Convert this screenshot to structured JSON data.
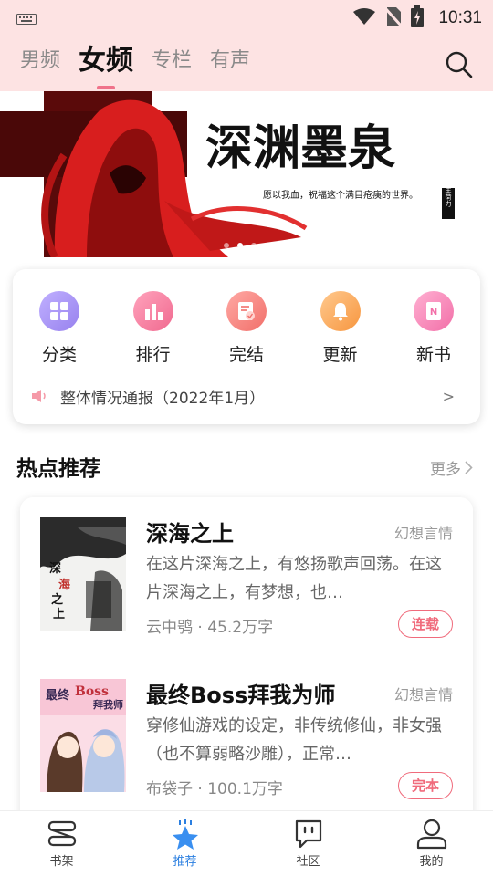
{
  "status_bar": {
    "time": "10:31"
  },
  "header": {
    "tabs": [
      {
        "label": "男频",
        "active": false
      },
      {
        "label": "女频",
        "active": true
      },
      {
        "label": "专栏",
        "active": false
      },
      {
        "label": "有声",
        "active": false
      }
    ],
    "search_icon": "search-icon"
  },
  "banner": {
    "title": "深渊墨泉",
    "subtitle": "愿以我血，祝福这个满目疮痍的世界。",
    "tag": "丰菏力",
    "dots": 3,
    "active_dot": 1
  },
  "quick_menu": {
    "items": [
      {
        "label": "分类",
        "icon": "grid-icon",
        "color": "#a893f0"
      },
      {
        "label": "排行",
        "icon": "bar-chart-icon",
        "color": "#f57fa0"
      },
      {
        "label": "完结",
        "icon": "completed-book-icon",
        "color": "#f6837f"
      },
      {
        "label": "更新",
        "icon": "bell-icon",
        "color": "#f9a35a"
      },
      {
        "label": "新书",
        "icon": "new-book-icon",
        "color": "#f48bb8"
      }
    ],
    "notice": {
      "text": "整体情况通报（2022年1月）",
      "arrow": ">",
      "icon": "speaker-icon"
    }
  },
  "hot": {
    "title": "热点推荐",
    "more": "更多",
    "books": [
      {
        "title": "深海之上",
        "genre": "幻想言情",
        "desc": "在这片深海之上，有悠扬歌声回荡。在这片深海之上，有梦想，也…",
        "meta": "云中鸮 · 45.2万字",
        "status": "连载",
        "cover_text": "深海之上"
      },
      {
        "title": "最终Boss拜我为师",
        "genre": "幻想言情",
        "desc": "穿修仙游戏的设定，非传统修仙，非女强（也不算弱略沙雕），正常…",
        "meta": "布袋子 · 100.1万字",
        "status": "完本",
        "cover_text": "最终Boss拜我为师"
      }
    ]
  },
  "bottom_nav": [
    {
      "label": "书架",
      "icon": "bookshelf-icon",
      "active": false
    },
    {
      "label": "推荐",
      "icon": "star-icon",
      "active": true
    },
    {
      "label": "社区",
      "icon": "chat-bubble-icon",
      "active": false
    },
    {
      "label": "我的",
      "icon": "user-icon",
      "active": false
    }
  ],
  "colors": {
    "accent": "#f0728a",
    "header_bg": "#fde3e3",
    "nav_active": "#2b7fe0",
    "banner_red": "#d81e1e"
  }
}
